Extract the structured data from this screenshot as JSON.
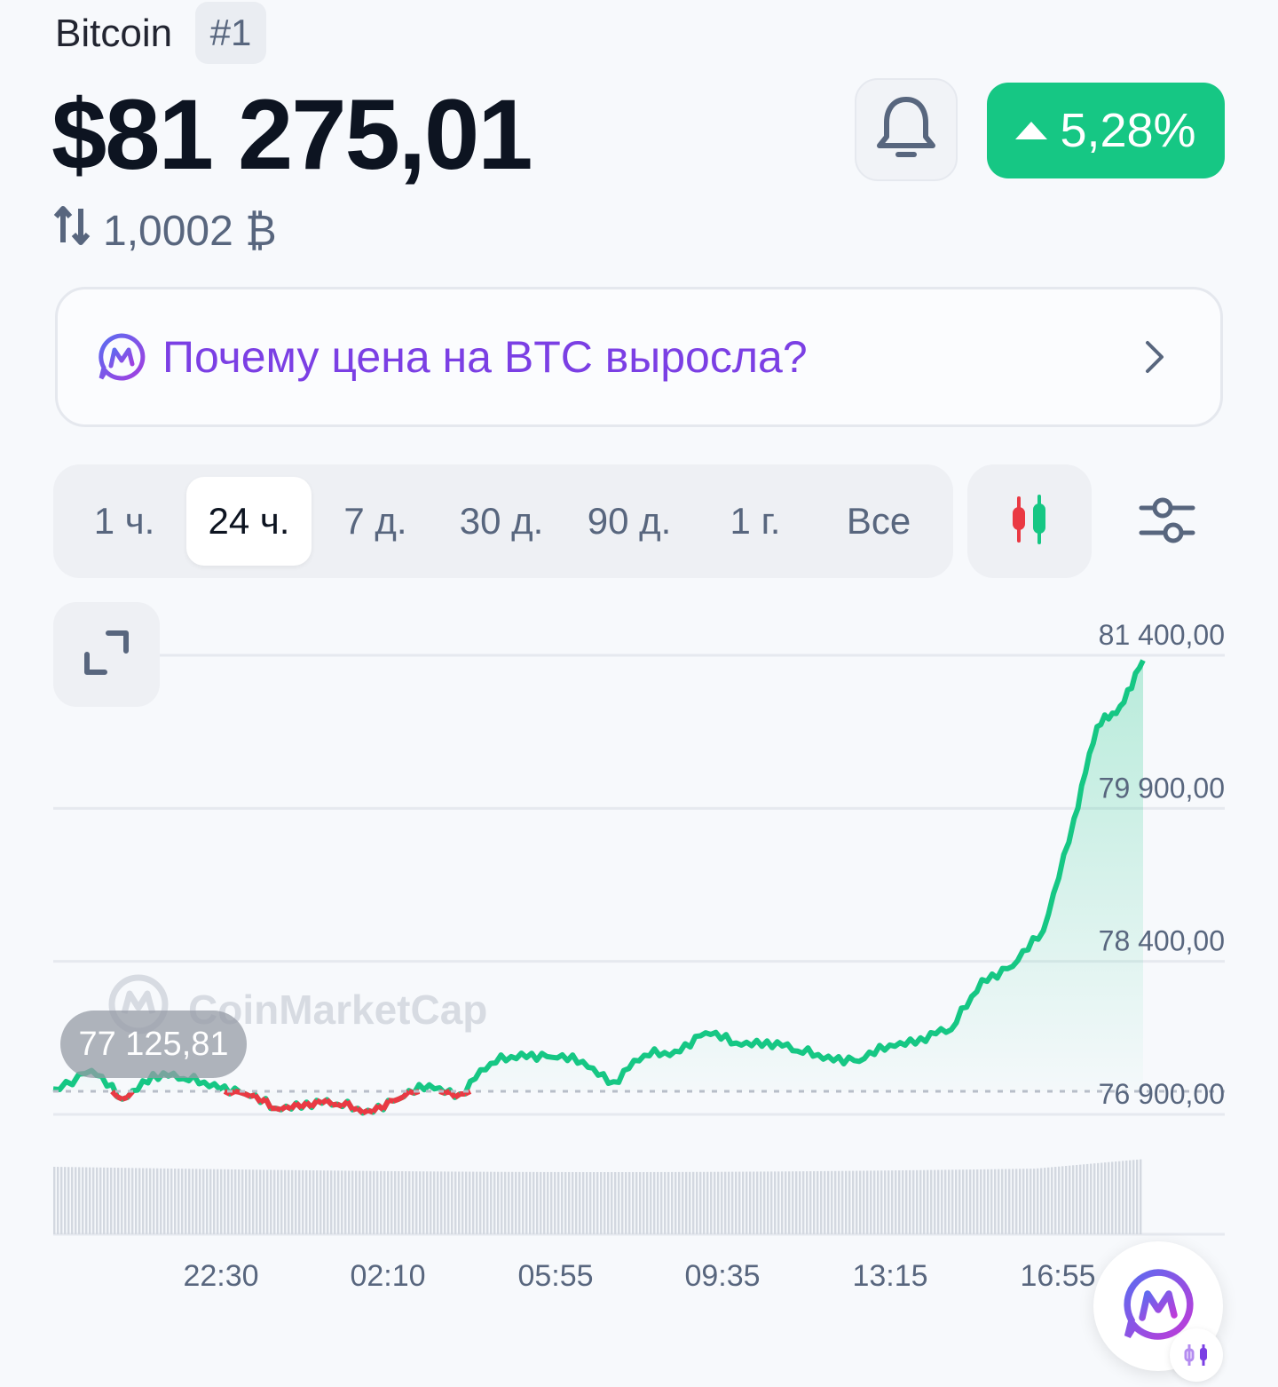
{
  "header": {
    "coin_name": "Bitcoin",
    "rank": "#1",
    "price": "$81 275,01",
    "btc_amount": "1,0002 ₿",
    "change": "5,28%"
  },
  "ask": {
    "text": "Почему цена на BTC выросла?"
  },
  "timeframes": [
    "1 ч.",
    "24 ч.",
    "7 д.",
    "30 д.",
    "90 д.",
    "1 г.",
    "Все"
  ],
  "active_timeframe": "24 ч.",
  "watermark": "CoinMarketCap",
  "colors": {
    "accent_green": "#16c784",
    "accent_red": "#ea3943",
    "brand_purple": "#7b3fe4"
  },
  "icons": [
    "bell-icon",
    "triangle-up-icon",
    "swap-arrows-icon",
    "cmc-ai-icon",
    "chevron-right-icon",
    "candlestick-icon",
    "sliders-icon",
    "expand-icon"
  ],
  "chart_data": {
    "type": "area",
    "y_tick_labels": [
      "81 400,00",
      "79 900,00",
      "78 400,00",
      "76 900,00"
    ],
    "y_ticks": [
      81400,
      79900,
      78400,
      76900
    ],
    "ylim": [
      76700,
      81600
    ],
    "x_tick_labels": [
      "22:30",
      "02:10",
      "05:55",
      "09:35",
      "13:15",
      "16:55"
    ],
    "baseline_value": 77125.81,
    "baseline_label": "77 125,81",
    "grid": true,
    "series": [
      {
        "x": [
          "20:10",
          "21:00",
          "21:40",
          "22:20",
          "23:00",
          "23:40",
          "00:20",
          "01:00",
          "01:40",
          "02:20",
          "03:00",
          "03:40",
          "04:20",
          "05:00",
          "05:40",
          "06:20",
          "07:00",
          "07:40",
          "08:20",
          "09:00",
          "09:40",
          "10:20",
          "11:00",
          "11:40",
          "12:20",
          "13:00",
          "13:40",
          "14:20",
          "15:00",
          "15:40",
          "16:20",
          "17:00",
          "17:40",
          "18:20",
          "18:50",
          "19:20",
          "19:50"
        ],
        "y": [
          77150,
          77330,
          77050,
          77300,
          77250,
          77200,
          77100,
          76960,
          77020,
          77000,
          76940,
          77050,
          77190,
          77100,
          77400,
          77500,
          77460,
          77420,
          77220,
          77480,
          77520,
          77700,
          77600,
          77620,
          77520,
          77470,
          77420,
          77580,
          77650,
          77730,
          78220,
          78350,
          78700,
          79800,
          80700,
          80900,
          81350
        ]
      }
    ],
    "volume": "bars along the bottom, roughly constant, rising slightly at the right"
  }
}
